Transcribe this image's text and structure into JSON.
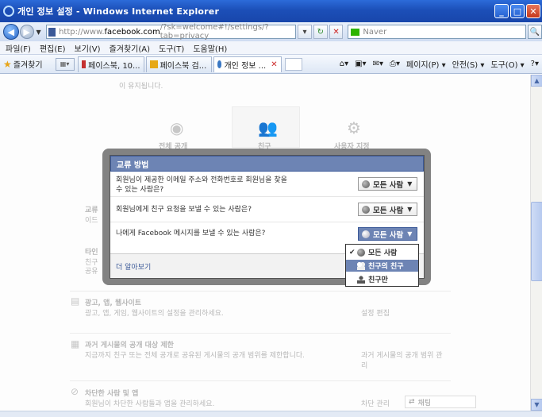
{
  "window": {
    "title": "개인 정보 설정 - Windows Internet Explorer"
  },
  "address": {
    "url_prefix": "http://www.",
    "url_host": "facebook.com",
    "url_rest": "/?sk=welcome#!/settings/?tab=privacy",
    "search_placeholder": "Naver"
  },
  "menu": [
    "파일(F)",
    "편집(E)",
    "보기(V)",
    "즐겨찾기(A)",
    "도구(T)",
    "도움말(H)"
  ],
  "favorites_label": "즐겨찾기",
  "tabs": [
    {
      "label": "페이스북, 10..."
    },
    {
      "label": "페이스북 검..."
    },
    {
      "label": "개인 정보 ..."
    }
  ],
  "command_bar": [
    "페이지(P) ▾",
    "안전(S) ▾",
    "도구(O) ▾"
  ],
  "background": {
    "note": "이 유지됩니다.",
    "tabs": [
      "전체 공개",
      "친구",
      "사용자 지정"
    ],
    "section1_title": "교류",
    "section1_sub": "이드",
    "section2_title": "타인",
    "section2_sub": "친구",
    "section2_sub2": "공유",
    "ads_title": "광고, 앱, 웹사이트",
    "ads_desc": "광고, 앱, 게임, 웹사이트의 설정을 관리하세요.",
    "ads_link": "설정 편집",
    "past_title": "과거 게시물의 공개 대상 제한",
    "past_desc": "지금까지 친구 또는 전체 공개로 공유된 게시물의 공개 범위를 제한합니다.",
    "past_link": "과거 게시물의 공개 범위 관리",
    "blocked_title": "차단한 사람 및 앱",
    "blocked_desc": "회원님이 차단한 사람들과 앱을 관리하세요.",
    "blocked_link": "차단 관리",
    "chat_label": "채팅"
  },
  "dialog": {
    "title": "교류 방법",
    "rows": [
      {
        "question_line1": "회원님이 제공한 이메일 주소와 전화번호로 회원님을 찾을",
        "question_line2": "수 있는 사람은?",
        "value": "모든 사람"
      },
      {
        "question_line1": "회원님에게 친구 요청을 보낼 수 있는 사람은?",
        "question_line2": "",
        "value": "모든 사람"
      },
      {
        "question_line1": "나에게 Facebook 메시지를 보낼 수 있는 사람은?",
        "question_line2": "",
        "value": "모든 사람"
      }
    ],
    "learn_more": "더 알아보기"
  },
  "dropdown": {
    "options": [
      {
        "label": "모든 사람",
        "checked": true,
        "icon": "globe-icon"
      },
      {
        "label": "친구의 친구",
        "checked": false,
        "icon": "people-icon",
        "highlighted": true
      },
      {
        "label": "친구만",
        "checked": false,
        "icon": "person-icon"
      }
    ]
  },
  "colors": {
    "fb_blue": "#3b5998",
    "fb_header": "#6d84b4",
    "ie_title": "#1c4fb8"
  }
}
